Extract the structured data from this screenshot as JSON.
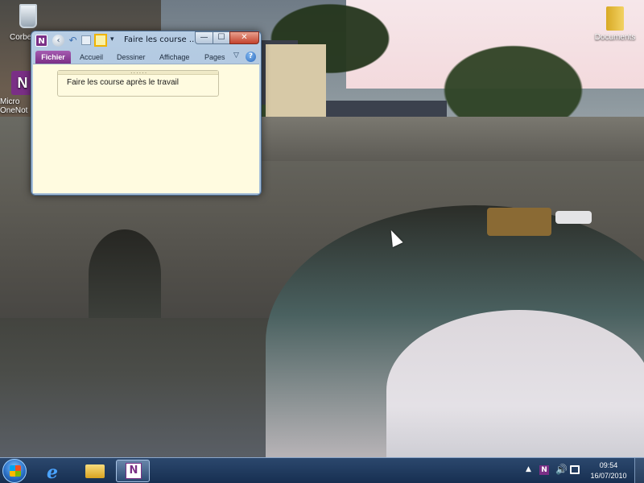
{
  "desktop": {
    "icons": [
      {
        "label": "Corbe"
      },
      {
        "label": "Micro\nOneNot"
      },
      {
        "label": "Documents"
      }
    ]
  },
  "window": {
    "app_icon": "N",
    "title": "Faire les course ...",
    "controls": {
      "minimize": "—",
      "maximize": "☐",
      "close": "✕"
    },
    "ribbon": {
      "tabs": [
        "Fichier",
        "Accueil",
        "Dessiner",
        "Affichage",
        "Pages"
      ],
      "collapse_icon": "chevron-down-icon",
      "help_icon": "?"
    },
    "note": {
      "grip": "......",
      "text": "Faire les course après le travail"
    }
  },
  "taskbar": {
    "apps": [
      "internet-explorer",
      "windows-explorer",
      "onenote"
    ],
    "tray": {
      "arrow": "▲",
      "onenote": "N",
      "speaker": "🔊"
    },
    "clock": {
      "time": "09:54",
      "date": "16/07/2010"
    }
  },
  "colors": {
    "onenote_brand": "#7a2f86",
    "note_background": "#fffbe0",
    "taskbar": "#1f3a63"
  }
}
